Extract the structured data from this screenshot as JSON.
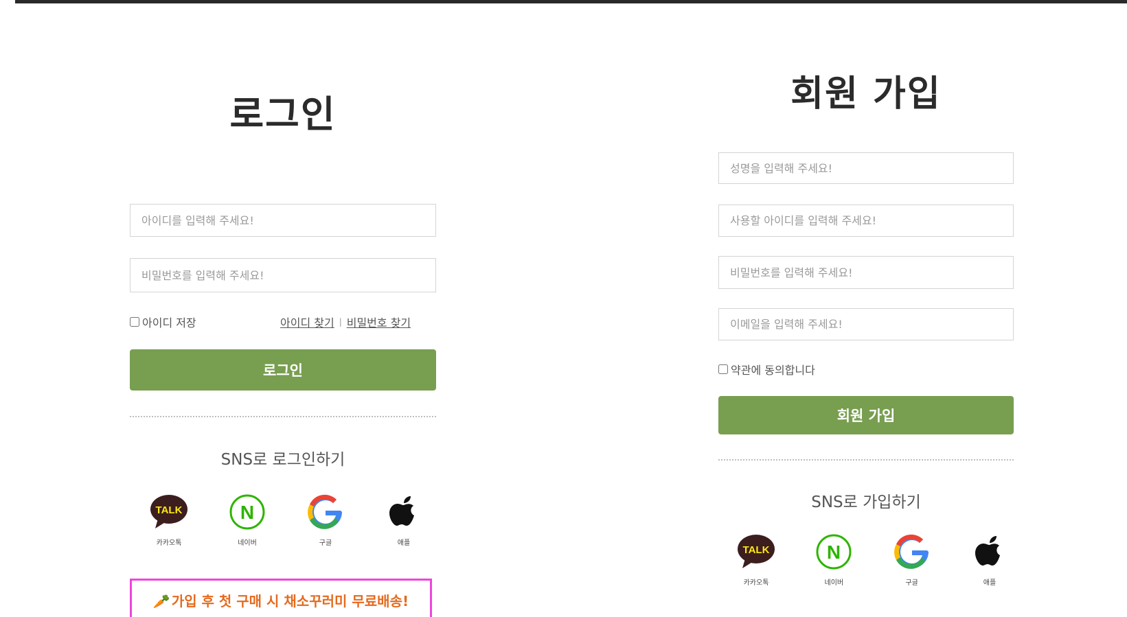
{
  "login": {
    "title": "로그인",
    "id_placeholder": "아이디를 입력해 주세요!",
    "pw_placeholder": "비밀번호를 입력해 주세요!",
    "remember_label": "아이디 저장",
    "find_id": "아이디 찾기",
    "separator": "|",
    "find_pw": "비밀번호 찾기",
    "submit_label": "로그인",
    "sns_title": "SNS로 로그인하기",
    "promo": "가입 후 첫 구매 시 채소꾸러미 무료배송!"
  },
  "signup": {
    "title": "회원 가입",
    "name_placeholder": "성명을 입력해 주세요!",
    "id_placeholder": "사용할 아이디를 입력해 주세요!",
    "pw_placeholder": "비밀번호를 입력해 주세요!",
    "email_placeholder": "이메일을 입력해 주세요!",
    "agree_label": "약관에 동의합니다",
    "submit_label": "회원 가입",
    "sns_title": "SNS로 가입하기"
  },
  "sns": {
    "kakao": {
      "badge": "TALK",
      "label": "카카오톡",
      "icon": "kakao-talk-icon"
    },
    "naver": {
      "badge": "N",
      "label": "네이버",
      "icon": "naver-icon"
    },
    "google": {
      "badge": "G",
      "label": "구글",
      "icon": "google-icon"
    },
    "apple": {
      "label": "애플",
      "icon": "apple-icon"
    }
  },
  "colors": {
    "button": "#789e50",
    "promo_border": "#ee44dd",
    "promo_text": "#e56a1d",
    "kakao_bubble": "#3c1e1e",
    "kakao_text": "#ffe812",
    "naver_green": "#2db400"
  }
}
